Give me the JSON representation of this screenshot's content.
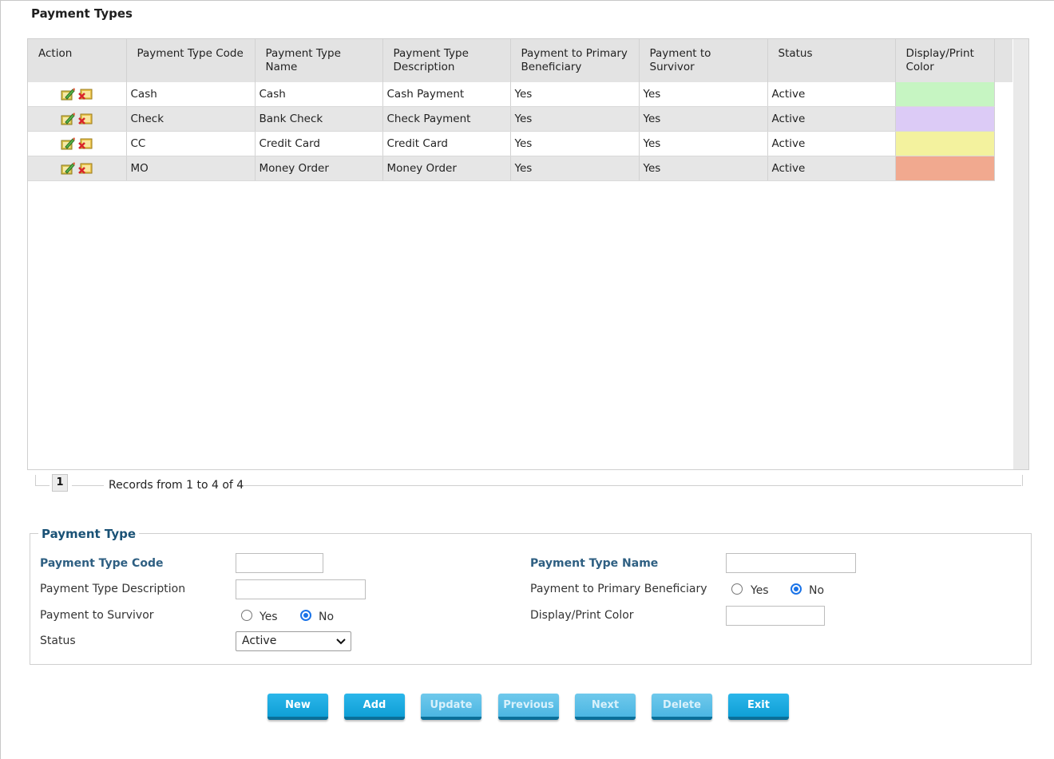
{
  "page": {
    "title": "Payment Types"
  },
  "grid": {
    "columns": [
      "Action",
      "Payment Type Code",
      "Payment Type Name",
      "Payment Type Description",
      "Payment to Primary Beneficiary",
      "Payment to Survivor",
      "Status",
      "Display/Print Color"
    ],
    "rows": [
      {
        "code": "Cash",
        "name": "Cash",
        "description": "Cash Payment",
        "primary": "Yes",
        "survivor": "Yes",
        "status": "Active",
        "color": "#c6f5c2"
      },
      {
        "code": "Check",
        "name": "Bank Check",
        "description": "Check Payment",
        "primary": "Yes",
        "survivor": "Yes",
        "status": "Active",
        "color": "#dccbf6"
      },
      {
        "code": "CC",
        "name": "Credit Card",
        "description": "Credit Card",
        "primary": "Yes",
        "survivor": "Yes",
        "status": "Active",
        "color": "#f3f29e"
      },
      {
        "code": "MO",
        "name": "Money Order",
        "description": "Money Order",
        "primary": "Yes",
        "survivor": "Yes",
        "status": "Active",
        "color": "#f1a98f"
      }
    ],
    "action_icons": [
      "edit-icon",
      "delete-icon"
    ]
  },
  "pager": {
    "current_page": "1",
    "records_text": "Records from 1 to 4 of 4"
  },
  "form": {
    "legend": "Payment Type",
    "code_label": "Payment Type Code",
    "code_value": "",
    "name_label": "Payment Type Name",
    "name_value": "",
    "description_label": "Payment Type Description",
    "description_value": "",
    "primary_label": "Payment to Primary Beneficiary",
    "survivor_label": "Payment to Survivor",
    "color_label": "Display/Print Color",
    "color_value": "",
    "status_label": "Status",
    "status_value": "Active",
    "yes_label": "Yes",
    "no_label": "No",
    "primary_selected": "No",
    "survivor_selected": "No"
  },
  "buttons": {
    "new": "New",
    "add": "Add",
    "update": "Update",
    "previous": "Previous",
    "next": "Next",
    "delete": "Delete",
    "exit": "Exit"
  },
  "colors": {
    "accent": "#1a9fd6",
    "legend": "#1a5276",
    "required_label": "#2e5f82"
  }
}
